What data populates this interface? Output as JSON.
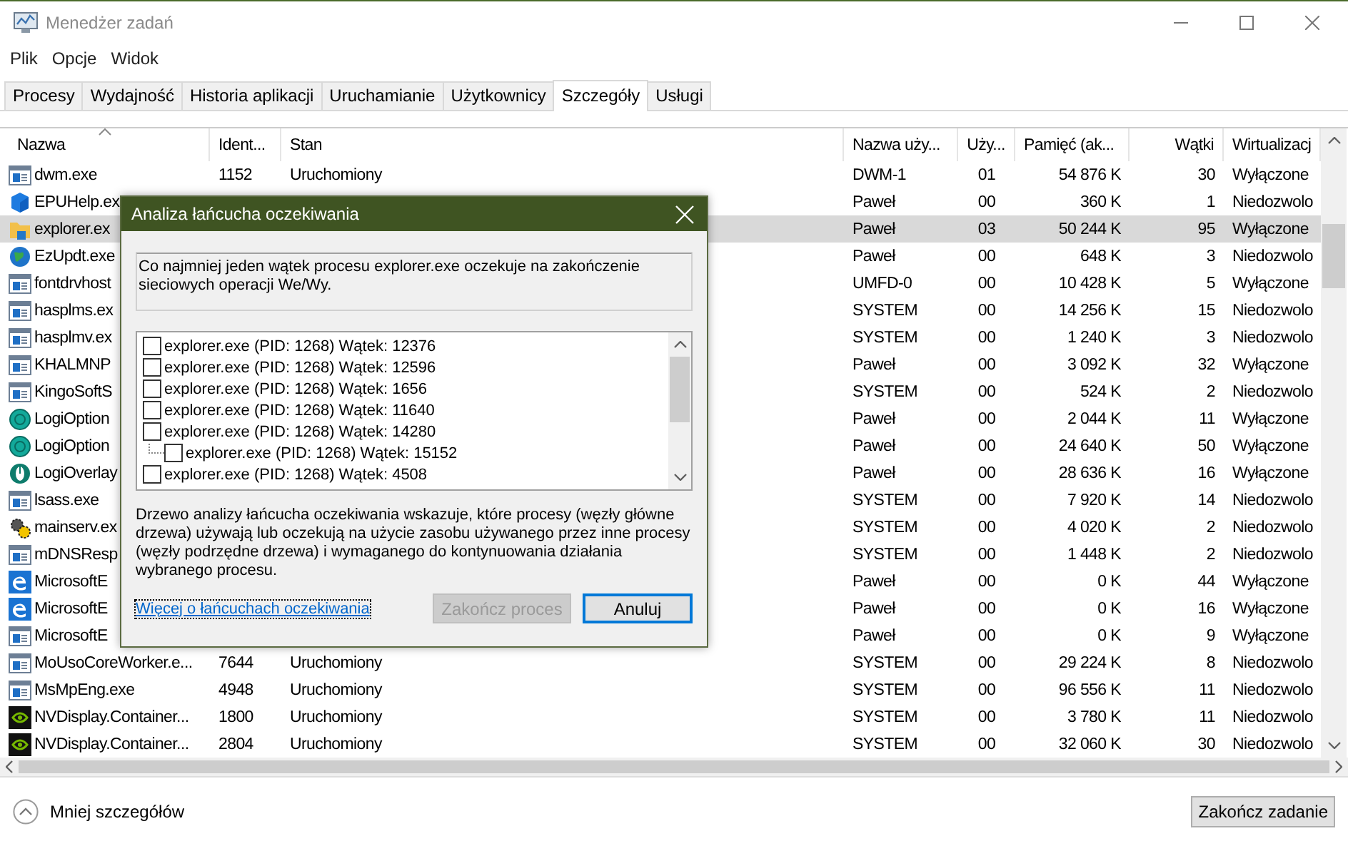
{
  "window": {
    "title": "Menedżer zadań"
  },
  "menu": [
    "Plik",
    "Opcje",
    "Widok"
  ],
  "tabs": [
    {
      "label": "Procesy",
      "selected": false
    },
    {
      "label": "Wydajność",
      "selected": false
    },
    {
      "label": "Historia aplikacji",
      "selected": false
    },
    {
      "label": "Uruchamianie",
      "selected": false
    },
    {
      "label": "Użytkownicy",
      "selected": false
    },
    {
      "label": "Szczegóły",
      "selected": true
    },
    {
      "label": "Usługi",
      "selected": false
    }
  ],
  "table": {
    "columns": [
      {
        "label": "Nazwa",
        "sorted": true
      },
      {
        "label": "Ident...",
        "sorted": false
      },
      {
        "label": "Stan",
        "sorted": false
      },
      {
        "label": "Nazwa uży...",
        "sorted": false
      },
      {
        "label": "Uży...",
        "sorted": false
      },
      {
        "label": "Pamięć (ak...",
        "sorted": false
      },
      {
        "label": "Wątki",
        "sorted": false
      },
      {
        "label": "Wirtualizacj",
        "sorted": false
      }
    ],
    "rows": [
      {
        "kind": "window",
        "selected": false,
        "cells": [
          "dwm.exe",
          "1152",
          "Uruchomiony",
          "DWM-1",
          "01",
          "54 876 K",
          "30",
          "Wyłączone"
        ]
      },
      {
        "kind": "cube",
        "selected": false,
        "cells": [
          "EPUHelp.ex",
          null,
          null,
          "Paweł",
          "00",
          "360 K",
          "1",
          "Niedozwolo"
        ]
      },
      {
        "kind": "folder",
        "selected": true,
        "cells": [
          "explorer.ex",
          null,
          null,
          "Paweł",
          "03",
          "50 244 K",
          "95",
          "Wyłączone"
        ]
      },
      {
        "kind": "globe",
        "selected": false,
        "cells": [
          "EzUpdt.exe",
          null,
          null,
          "Paweł",
          "00",
          "648 K",
          "3",
          "Niedozwolo"
        ]
      },
      {
        "kind": "window",
        "selected": false,
        "cells": [
          "fontdrvhost",
          null,
          null,
          "UMFD-0",
          "00",
          "10 428 K",
          "5",
          "Wyłączone"
        ]
      },
      {
        "kind": "window",
        "selected": false,
        "cells": [
          "hasplms.ex",
          null,
          null,
          "SYSTEM",
          "00",
          "14 256 K",
          "15",
          "Niedozwolo"
        ]
      },
      {
        "kind": "window",
        "selected": false,
        "cells": [
          "hasplmv.ex",
          null,
          null,
          "SYSTEM",
          "00",
          "1 240 K",
          "3",
          "Niedozwolo"
        ]
      },
      {
        "kind": "window",
        "selected": false,
        "cells": [
          "KHALMNP",
          null,
          null,
          "Paweł",
          "00",
          "3 092 K",
          "32",
          "Wyłączone"
        ]
      },
      {
        "kind": "window",
        "selected": false,
        "cells": [
          "KingoSoftS",
          null,
          null,
          "SYSTEM",
          "00",
          "524 K",
          "2",
          "Niedozwolo"
        ]
      },
      {
        "kind": "logi",
        "selected": false,
        "cells": [
          "LogiOption",
          null,
          null,
          "Paweł",
          "00",
          "2 044 K",
          "11",
          "Wyłączone"
        ]
      },
      {
        "kind": "logi",
        "selected": false,
        "cells": [
          "LogiOption",
          null,
          null,
          "Paweł",
          "00",
          "24 640 K",
          "50",
          "Wyłączone"
        ]
      },
      {
        "kind": "overlay",
        "selected": false,
        "cells": [
          "LogiOverlay",
          null,
          null,
          "Paweł",
          "00",
          "28 636 K",
          "16",
          "Wyłączone"
        ]
      },
      {
        "kind": "window",
        "selected": false,
        "cells": [
          "lsass.exe",
          null,
          null,
          "SYSTEM",
          "00",
          "7 920 K",
          "14",
          "Niedozwolo"
        ]
      },
      {
        "kind": "gears",
        "selected": false,
        "cells": [
          "mainserv.ex",
          null,
          null,
          "SYSTEM",
          "00",
          "4 020 K",
          "2",
          "Niedozwolo"
        ]
      },
      {
        "kind": "window",
        "selected": false,
        "cells": [
          "mDNSResp",
          null,
          null,
          "SYSTEM",
          "00",
          "1 448 K",
          "2",
          "Niedozwolo"
        ]
      },
      {
        "kind": "edge",
        "selected": false,
        "cells": [
          "MicrosoftE",
          null,
          null,
          "Paweł",
          "00",
          "0 K",
          "44",
          "Wyłączone"
        ]
      },
      {
        "kind": "edge",
        "selected": false,
        "cells": [
          "MicrosoftE",
          null,
          null,
          "Paweł",
          "00",
          "0 K",
          "16",
          "Wyłączone"
        ]
      },
      {
        "kind": "window",
        "selected": false,
        "cells": [
          "MicrosoftE",
          null,
          null,
          "Paweł",
          "00",
          "0 K",
          "9",
          "Wyłączone"
        ]
      },
      {
        "kind": "window",
        "selected": false,
        "cells": [
          "MoUsoCoreWorker.e...",
          "7644",
          "Uruchomiony",
          "SYSTEM",
          "00",
          "29 224 K",
          "8",
          "Niedozwolo"
        ]
      },
      {
        "kind": "window",
        "selected": false,
        "cells": [
          "MsMpEng.exe",
          "4948",
          "Uruchomiony",
          "SYSTEM",
          "00",
          "96 556 K",
          "11",
          "Niedozwolo"
        ]
      },
      {
        "kind": "nvidia",
        "selected": false,
        "cells": [
          "NVDisplay.Container...",
          "1800",
          "Uruchomiony",
          "SYSTEM",
          "00",
          "3 780 K",
          "11",
          "Niedozwolo"
        ]
      },
      {
        "kind": "nvidia",
        "selected": false,
        "cells": [
          "NVDisplay.Container...",
          "2804",
          "Uruchomiony",
          "SYSTEM",
          "00",
          "32 060 K",
          "30",
          "Niedozwolo"
        ]
      }
    ]
  },
  "footer": {
    "details_link": "Mniej szczegółów",
    "end_task_button": "Zakończ zadanie"
  },
  "dialog": {
    "title": "Analiza łańcucha oczekiwania",
    "message": "Co najmniej jeden wątek procesu explorer.exe oczekuje na zakończenie sieciowych operacji We/Wy.",
    "threads": [
      {
        "label": "explorer.exe (PID: 1268) Wątek: 12376",
        "checked": false
      },
      {
        "label": "explorer.exe (PID: 1268) Wątek: 12596",
        "checked": false
      },
      {
        "label": "explorer.exe (PID: 1268) Wątek: 1656",
        "checked": false
      },
      {
        "label": "explorer.exe (PID: 1268) Wątek: 11640",
        "checked": false
      },
      {
        "label": "explorer.exe (PID: 1268) Wątek: 14280",
        "checked": false,
        "children": [
          {
            "label": "explorer.exe (PID: 1268) Wątek: 15152",
            "checked": false
          }
        ]
      },
      {
        "label": "explorer.exe (PID: 1268) Wątek: 4508",
        "checked": false
      }
    ],
    "description": "Drzewo analizy łańcucha oczekiwania wskazuje, które procesy (węzły główne drzewa) używają lub oczekują na użycie zasobu używanego przez inne procesy (węzły podrzędne drzewa) i wymaganego do kontynuowania działania wybranego procesu.",
    "link": "Więcej o łańcuchach oczekiwania",
    "buttons": [
      {
        "label": "Zakończ proces",
        "disabled": true,
        "default": false
      },
      {
        "label": "Anuluj",
        "disabled": false,
        "default": true
      }
    ]
  }
}
